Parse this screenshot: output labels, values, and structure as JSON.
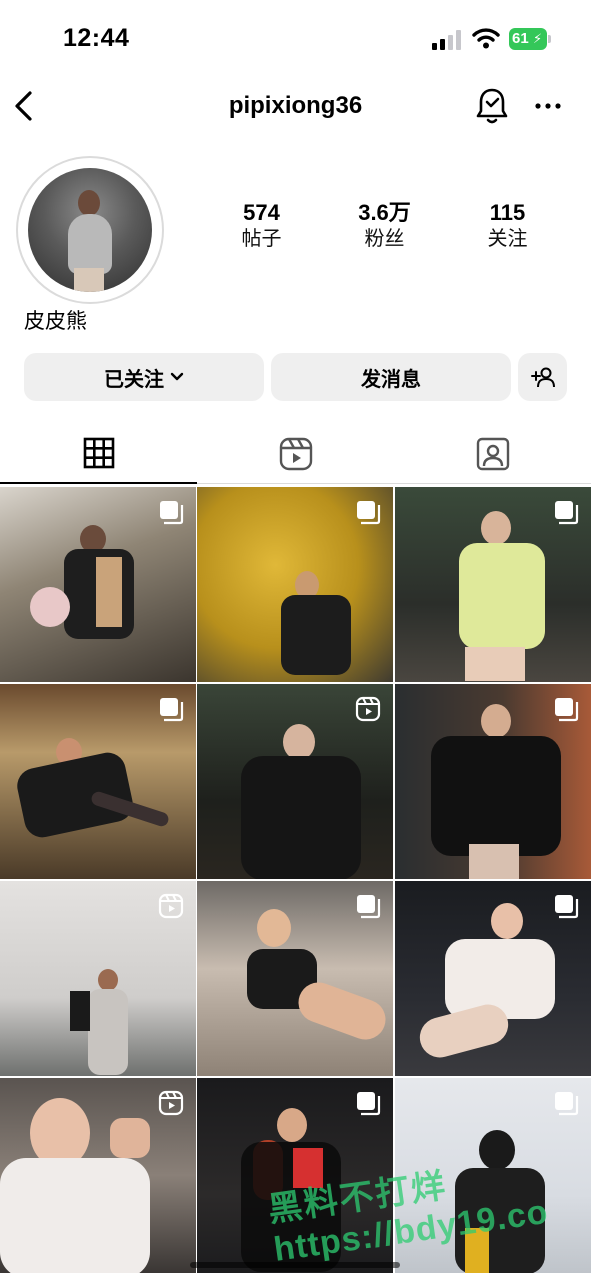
{
  "status_bar": {
    "time": "12:44",
    "battery": "61"
  },
  "nav": {
    "username": "pipixiong36"
  },
  "profile": {
    "display_name": "皮皮熊",
    "stats": [
      {
        "value": "574",
        "label": "帖子"
      },
      {
        "value": "3.6万",
        "label": "粉丝"
      },
      {
        "value": "115",
        "label": "关注"
      }
    ]
  },
  "actions": {
    "following_label": "已关注",
    "message_label": "发消息"
  },
  "tabs": [
    {
      "icon": "grid-icon",
      "active": true
    },
    {
      "icon": "reels-icon",
      "active": false
    },
    {
      "icon": "tagged-icon",
      "active": false
    }
  ],
  "posts": [
    {
      "badge": "carousel-icon"
    },
    {
      "badge": "carousel-icon"
    },
    {
      "badge": "carousel-icon"
    },
    {
      "badge": "carousel-icon"
    },
    {
      "badge": "reels-icon"
    },
    {
      "badge": "carousel-icon"
    },
    {
      "badge": "reels-icon"
    },
    {
      "badge": "carousel-icon"
    },
    {
      "badge": "carousel-icon"
    },
    {
      "badge": "reels-icon"
    },
    {
      "badge": "carousel-icon"
    },
    {
      "badge": "carousel-icon"
    }
  ],
  "watermark": {
    "line1": "黑料不打烊",
    "line2": "https://bdy19.co"
  }
}
